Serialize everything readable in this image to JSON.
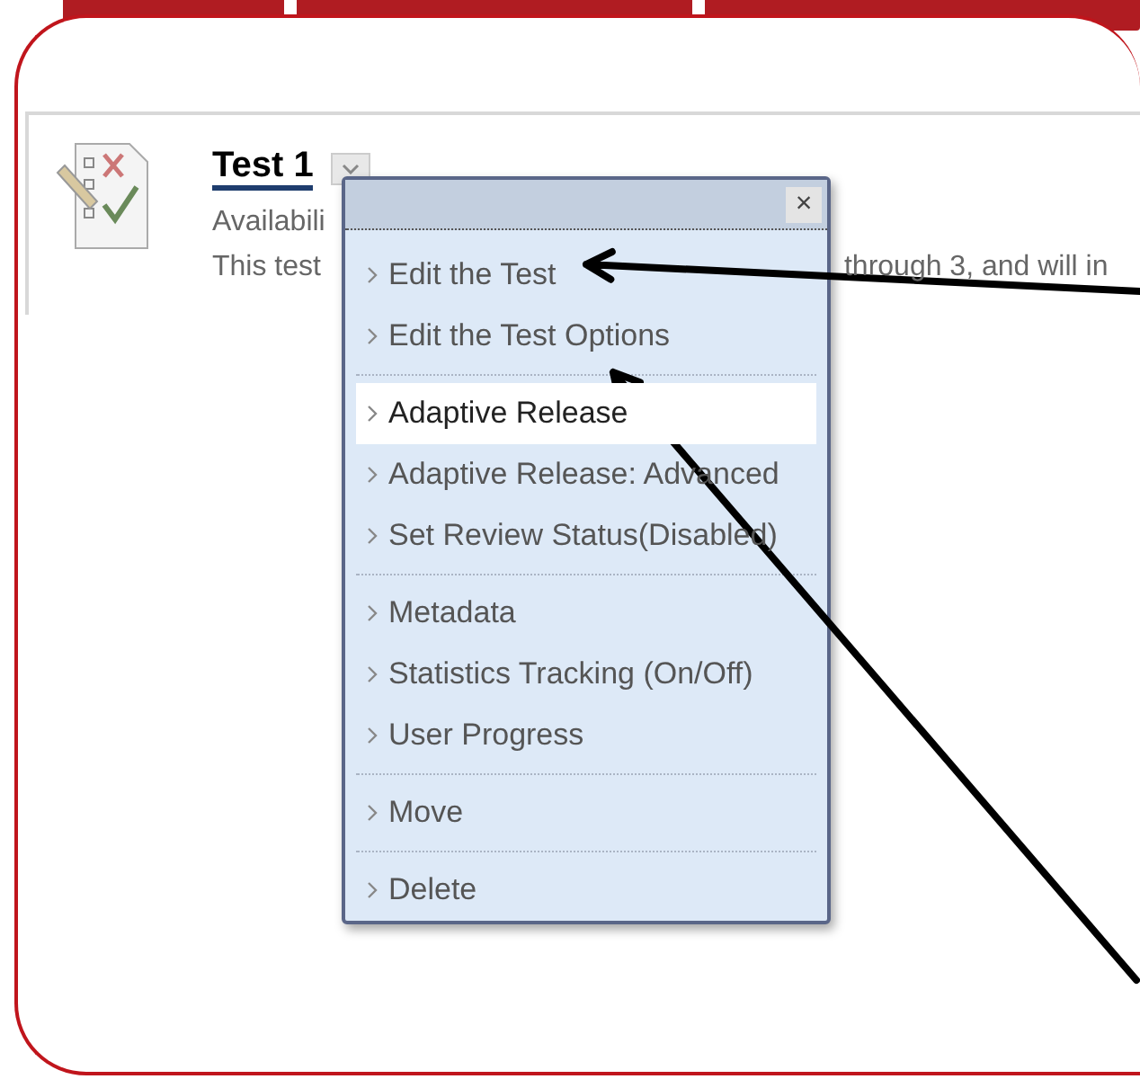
{
  "item": {
    "title": "Test 1",
    "availability": "Availabili",
    "description_start": "This test",
    "description_end": "through 3, and will in"
  },
  "menu": {
    "close": "×",
    "groups": [
      {
        "items": [
          {
            "label": "Edit the Test",
            "selected": false
          },
          {
            "label": "Edit the Test Options",
            "selected": false
          }
        ]
      },
      {
        "items": [
          {
            "label": "Adaptive Release",
            "selected": true
          },
          {
            "label": "Adaptive Release: Advanced",
            "selected": false
          },
          {
            "label": "Set Review Status(Disabled)",
            "selected": false
          }
        ]
      },
      {
        "items": [
          {
            "label": "Metadata",
            "selected": false
          },
          {
            "label": "Statistics Tracking (On/Off)",
            "selected": false
          },
          {
            "label": "User Progress",
            "selected": false
          }
        ]
      },
      {
        "items": [
          {
            "label": "Move",
            "selected": false
          }
        ]
      },
      {
        "items": [
          {
            "label": "Delete",
            "selected": false
          }
        ]
      }
    ]
  },
  "annotations": [
    {
      "kind": "arrow"
    },
    {
      "kind": "arrow"
    }
  ]
}
